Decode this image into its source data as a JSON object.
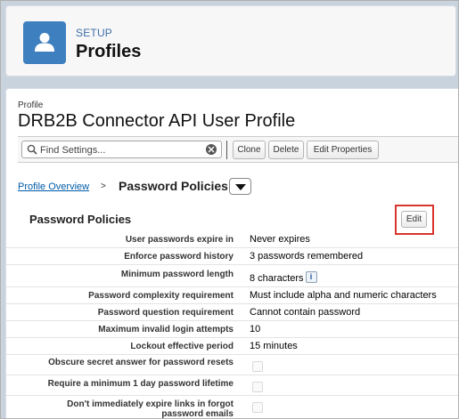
{
  "header": {
    "supertitle": "SETUP",
    "title": "Profiles",
    "icon": "user-icon"
  },
  "profile": {
    "label": "Profile",
    "name": "DRB2B Connector API User Profile"
  },
  "toolbar": {
    "search_placeholder": "Find Settings...",
    "clone_label": "Clone",
    "delete_label": "Delete",
    "edit_properties_label": "Edit Properties"
  },
  "breadcrumb": {
    "overview_link": "Profile Overview",
    "separator": ">",
    "current": "Password Policies"
  },
  "section": {
    "title": "Password Policies",
    "edit_label": "Edit",
    "highlight_color": "#d8352e"
  },
  "policies": [
    {
      "label": "User passwords expire in",
      "value": "Never expires"
    },
    {
      "label": "Enforce password history",
      "value": "3 passwords remembered"
    },
    {
      "label": "Minimum password length",
      "value": "8 characters",
      "info": "i"
    },
    {
      "label": "Password complexity requirement",
      "value": "Must include alpha and numeric characters"
    },
    {
      "label": "Password question requirement",
      "value": "Cannot contain password"
    },
    {
      "label": "Maximum invalid login attempts",
      "value": "10"
    },
    {
      "label": "Lockout effective period",
      "value": "15 minutes"
    },
    {
      "label": "Obscure secret answer for password resets",
      "checked": false
    },
    {
      "label": "Require a minimum 1 day password lifetime",
      "checked": false
    },
    {
      "label": "Don't immediately expire links in forgot password emails",
      "checked": false
    }
  ]
}
